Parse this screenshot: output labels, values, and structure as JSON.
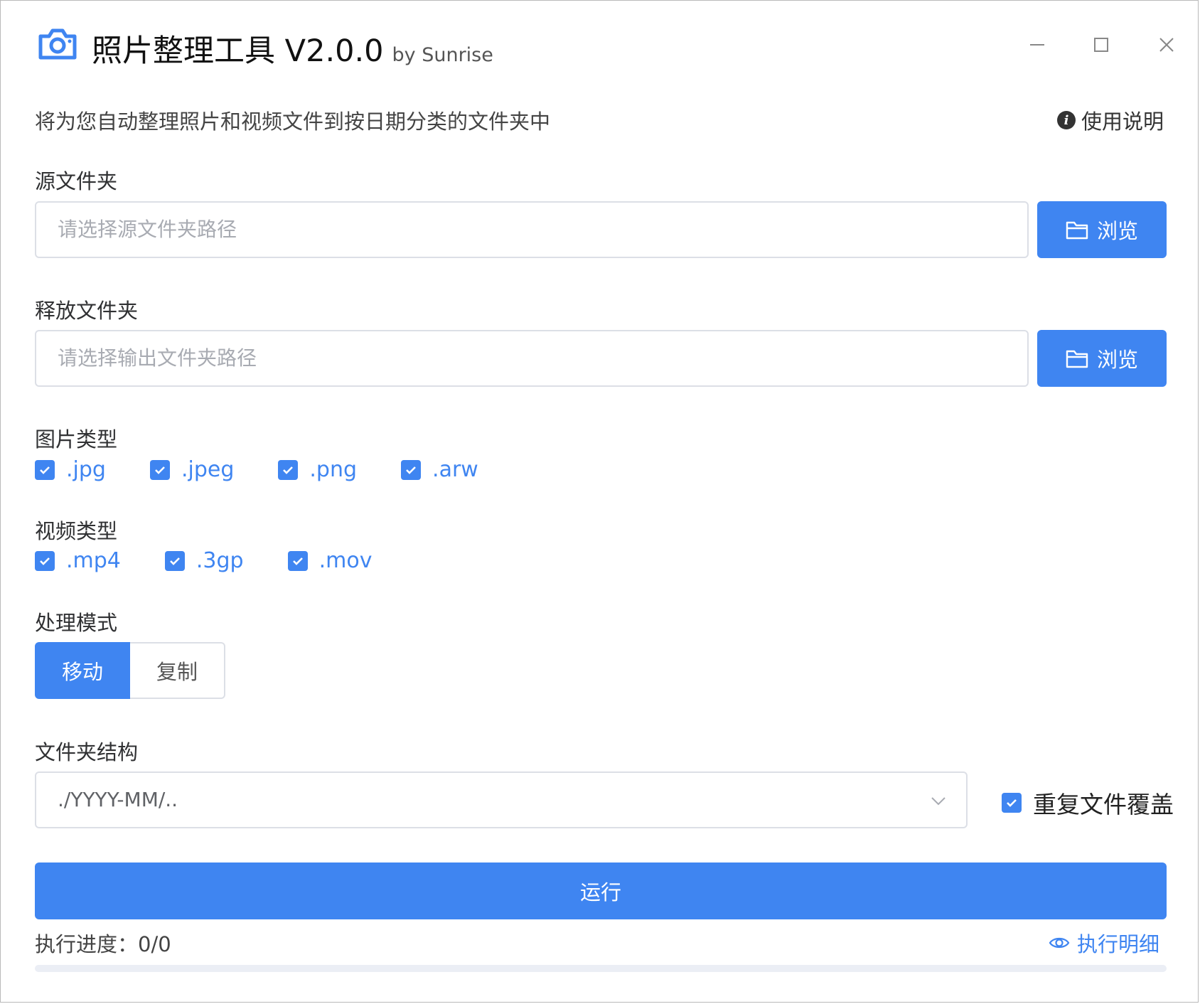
{
  "window": {
    "title": "照片整理工具 V2.0.0",
    "by": "by Sunrise",
    "app_icon": "camera-icon"
  },
  "subtitle": "将为您自动整理照片和视频文件到按日期分类的文件夹中",
  "help": {
    "label": "使用说明",
    "icon": "info-icon"
  },
  "source": {
    "label": "源文件夹",
    "value": "",
    "placeholder": "请选择源文件夹路径",
    "browse_label": "浏览"
  },
  "output": {
    "label": "释放文件夹",
    "value": "",
    "placeholder": "请选择输出文件夹路径",
    "browse_label": "浏览"
  },
  "image_types": {
    "label": "图片类型",
    "options": [
      {
        "label": ".jpg",
        "checked": true
      },
      {
        "label": ".jpeg",
        "checked": true
      },
      {
        "label": ".png",
        "checked": true
      },
      {
        "label": ".arw",
        "checked": true
      }
    ]
  },
  "video_types": {
    "label": "视频类型",
    "options": [
      {
        "label": ".mp4",
        "checked": true
      },
      {
        "label": ".3gp",
        "checked": true
      },
      {
        "label": ".mov",
        "checked": true
      }
    ]
  },
  "mode": {
    "label": "处理模式",
    "options": [
      "移动",
      "复制"
    ],
    "selected": "移动"
  },
  "structure": {
    "label": "文件夹结构",
    "selected": "./YYYY-MM/..",
    "overwrite_label": "重复文件覆盖",
    "overwrite_checked": true
  },
  "run": {
    "label": "运行"
  },
  "progress": {
    "text": "执行进度：0/0",
    "fraction": 0,
    "detail_label": "执行明细"
  },
  "colors": {
    "accent": "#3f85f1",
    "border": "#dcdfe6",
    "placeholder": "#a8abb2"
  }
}
